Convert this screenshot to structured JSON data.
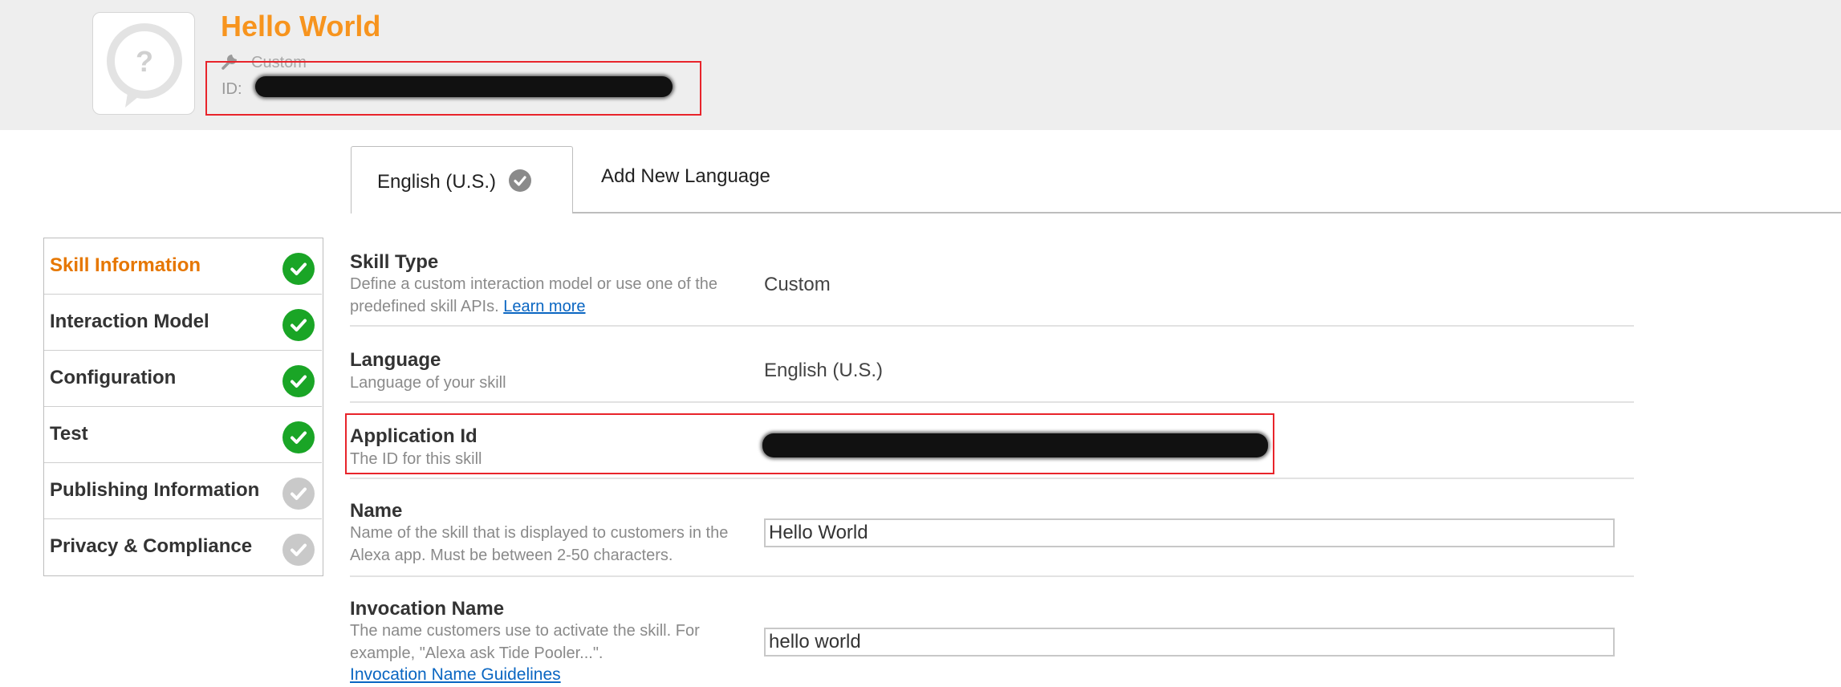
{
  "header": {
    "skill_name": "Hello World",
    "skill_type": "Custom",
    "id_label": "ID:"
  },
  "tabs": {
    "active_label": "English (U.S.)",
    "add_label": "Add New Language"
  },
  "sidebar": {
    "items": [
      {
        "label": "Skill Information",
        "complete": true
      },
      {
        "label": "Interaction Model",
        "complete": true
      },
      {
        "label": "Configuration",
        "complete": true
      },
      {
        "label": "Test",
        "complete": true
      },
      {
        "label": "Publishing Information",
        "complete": false
      },
      {
        "label": "Privacy & Compliance",
        "complete": false
      }
    ]
  },
  "fields": {
    "skill_type": {
      "title": "Skill Type",
      "desc": "Define a custom interaction model or use one of the predefined skill APIs.",
      "link": "Learn more",
      "value": "Custom"
    },
    "language": {
      "title": "Language",
      "desc": "Language of your skill",
      "value": "English (U.S.)"
    },
    "application_id": {
      "title": "Application Id",
      "desc": "The ID for this skill"
    },
    "name": {
      "title": "Name",
      "desc": "Name of the skill that is displayed to customers in the Alexa app. Must be between 2-50 characters.",
      "value": "Hello World"
    },
    "invocation_name": {
      "title": "Invocation Name",
      "desc": "The name customers use to activate the skill. For example, \"Alexa ask Tide Pooler...\".",
      "link": "Invocation Name Guidelines",
      "value": "hello world"
    }
  },
  "colors": {
    "accent": "#f7941e",
    "active_nav": "#e67700",
    "complete_check": "#1aa526",
    "pending_check": "#c9c9c9",
    "link": "#0a66c2",
    "annotation": "#e8242b"
  }
}
